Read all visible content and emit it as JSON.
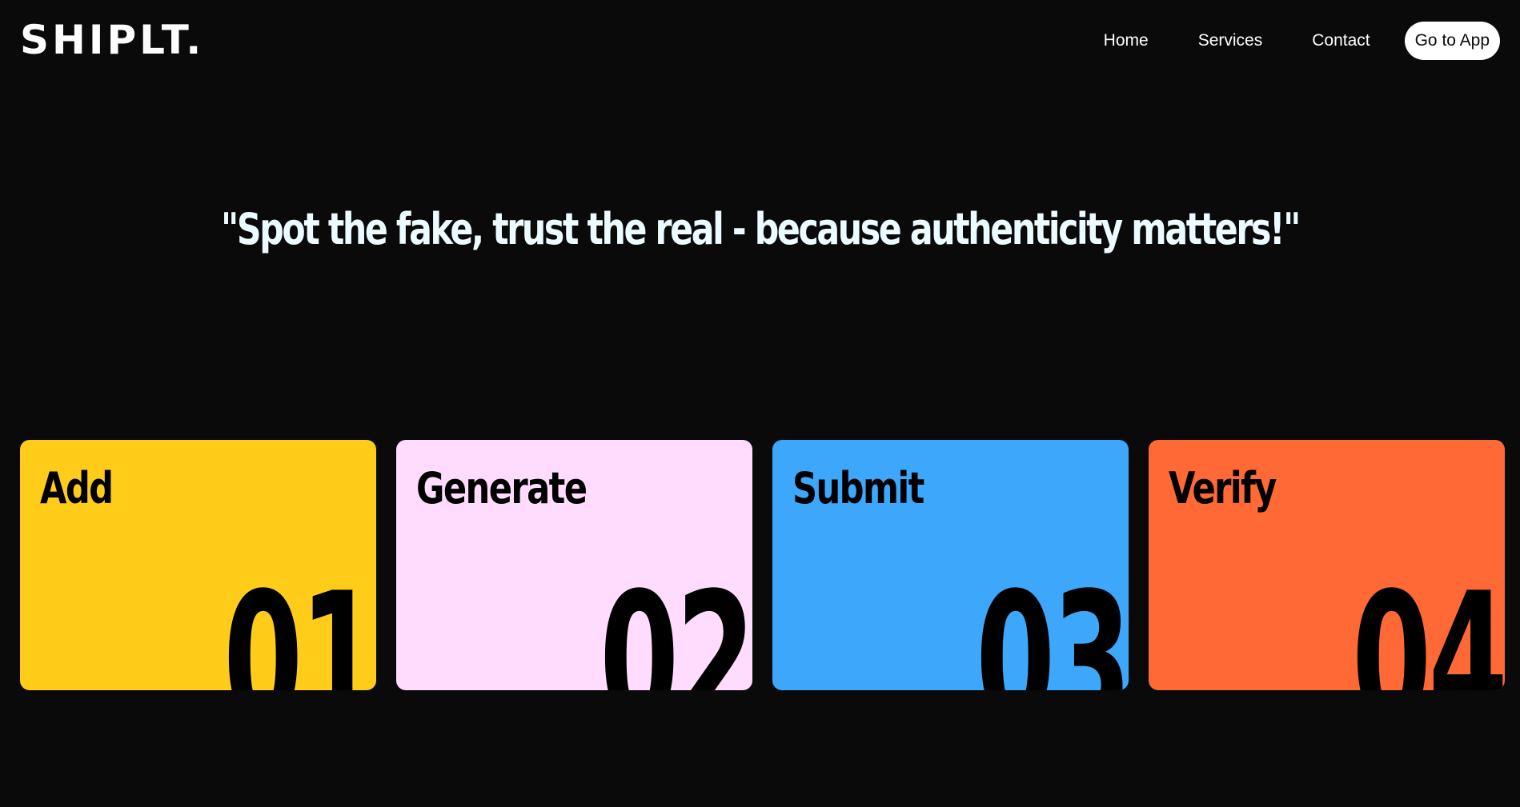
{
  "header": {
    "logo": "SHIPLT.",
    "nav": [
      {
        "label": "Home"
      },
      {
        "label": "Services"
      },
      {
        "label": "Contact"
      }
    ],
    "cta_label": "Go to App"
  },
  "hero": {
    "quote": "\"Spot the fake, trust the real - because authenticity matters!\""
  },
  "steps": [
    {
      "title": "Add",
      "number": "01",
      "color": "#ffcc1a"
    },
    {
      "title": "Generate",
      "number": "02",
      "color": "#ffdcfd"
    },
    {
      "title": "Submit",
      "number": "03",
      "color": "#3da7fc"
    },
    {
      "title": "Verify",
      "number": "04",
      "color": "#ff6935"
    }
  ],
  "colors": {
    "background": "#0a0a0a",
    "text": "#ffffff",
    "quote": "#ecfbff"
  }
}
